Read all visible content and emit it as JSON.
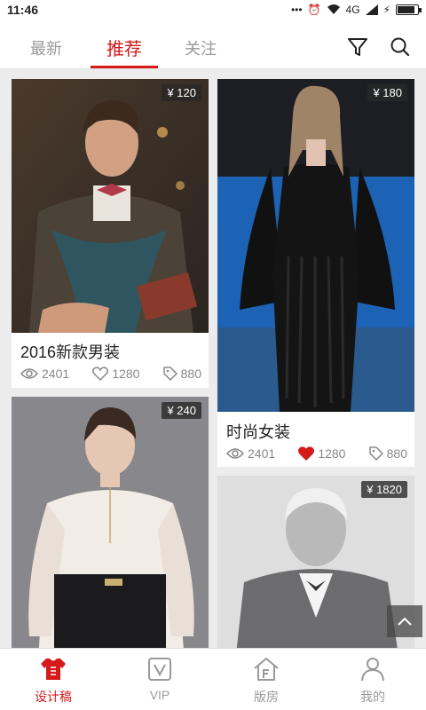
{
  "status_bar": {
    "time": "11:46",
    "signal_text": "4G",
    "battery_level": 0.9
  },
  "top_tabs": [
    {
      "label": "最新",
      "active": false
    },
    {
      "label": "推荐",
      "active": true
    },
    {
      "label": "关注",
      "active": false
    }
  ],
  "top_icons": [
    "filter-icon",
    "search-icon"
  ],
  "cards": [
    {
      "price": "¥ 120",
      "title": "2016新款男装",
      "views": "2401",
      "likes": "1280",
      "tags": "880",
      "liked": false
    },
    {
      "price": "¥ 180",
      "title": "时尚女装",
      "views": "2401",
      "likes": "1280",
      "tags": "880",
      "liked": true
    },
    {
      "price": "¥ 240"
    },
    {
      "price": "¥ 1820"
    }
  ],
  "bottom_nav": [
    {
      "label": "设计稿",
      "icon": "design-shirt-icon",
      "active": true
    },
    {
      "label": "VIP",
      "icon": "vip-icon",
      "active": false
    },
    {
      "label": "版房",
      "icon": "workshop-icon",
      "active": false
    },
    {
      "label": "我的",
      "icon": "profile-icon",
      "active": false
    }
  ],
  "colors": {
    "accent": "#d51a1a",
    "inactive": "#999999",
    "background": "#ececec"
  }
}
